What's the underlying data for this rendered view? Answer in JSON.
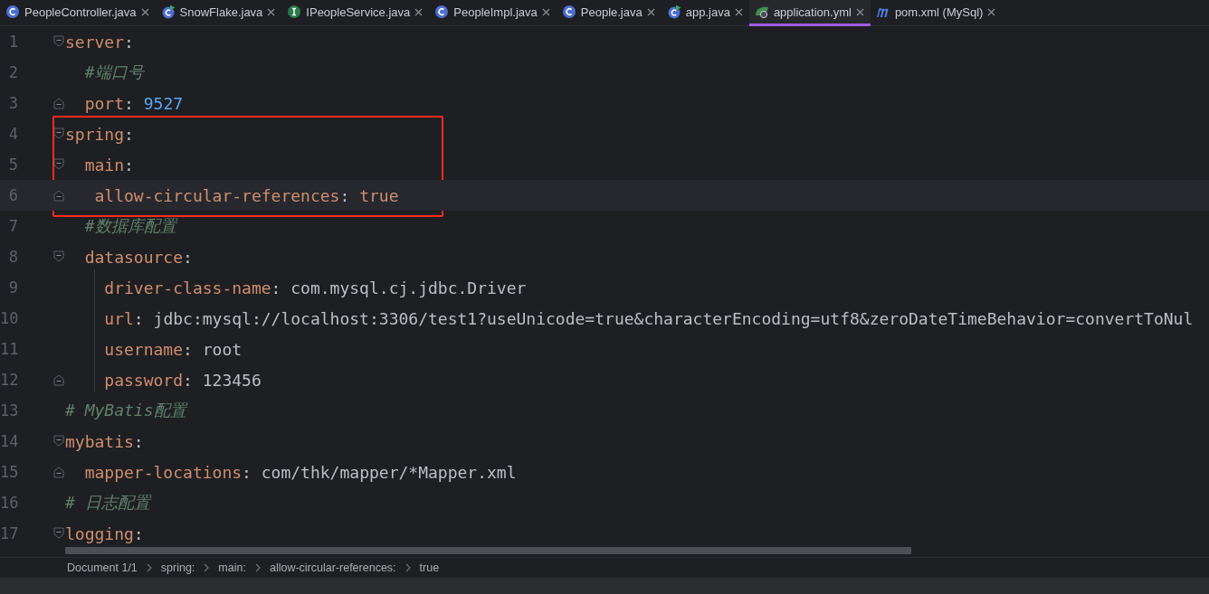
{
  "tabs": [
    {
      "label": "PeopleController.java",
      "kind": "class",
      "selected": false
    },
    {
      "label": "SnowFlake.java",
      "kind": "runnable",
      "selected": false
    },
    {
      "label": "IPeopleService.java",
      "kind": "interface",
      "selected": false
    },
    {
      "label": "PeopleImpl.java",
      "kind": "class",
      "selected": false
    },
    {
      "label": "People.java",
      "kind": "class",
      "selected": false
    },
    {
      "label": "app.java",
      "kind": "runnable",
      "selected": false
    },
    {
      "label": "application.yml",
      "kind": "config",
      "selected": true
    },
    {
      "label": "pom.xml (MySql)",
      "kind": "maven",
      "selected": false
    }
  ],
  "editor": {
    "lines": [
      {
        "number": "1",
        "kind": "fold-start",
        "current": false,
        "boxed": false,
        "tokens": [
          {
            "kind": "key",
            "text": "server"
          },
          {
            "kind": "punct",
            "text": ":"
          }
        ]
      },
      {
        "number": "2",
        "kind": "plain",
        "current": false,
        "boxed": false,
        "tokens": [
          {
            "kind": "comment",
            "text": "  #端口号"
          }
        ]
      },
      {
        "number": "3",
        "kind": "fold-end",
        "current": false,
        "boxed": false,
        "tokens": [
          {
            "kind": "key",
            "text": "  port"
          },
          {
            "kind": "punct",
            "text": ": "
          },
          {
            "kind": "number",
            "text": "9527"
          }
        ]
      },
      {
        "number": "4",
        "kind": "fold-start",
        "current": false,
        "boxed": true,
        "tokens": [
          {
            "kind": "key",
            "text": "spring"
          },
          {
            "kind": "punct",
            "text": ":"
          }
        ]
      },
      {
        "number": "5",
        "kind": "fold-start",
        "current": false,
        "boxed": true,
        "tokens": [
          {
            "kind": "key",
            "text": "  main"
          },
          {
            "kind": "punct",
            "text": ":"
          }
        ]
      },
      {
        "number": "6",
        "kind": "fold-end",
        "current": true,
        "boxed": true,
        "tokens": [
          {
            "kind": "key",
            "text": "   allow-circular-references"
          },
          {
            "kind": "punct",
            "text": ": "
          },
          {
            "kind": "keyword",
            "text": "true"
          }
        ]
      },
      {
        "number": "7",
        "kind": "plain",
        "current": false,
        "boxed": false,
        "tokens": [
          {
            "kind": "comment",
            "text": "  #数据库配置"
          }
        ]
      },
      {
        "number": "8",
        "kind": "fold-start",
        "current": false,
        "boxed": false,
        "tokens": [
          {
            "kind": "key",
            "text": "  datasource"
          },
          {
            "kind": "punct",
            "text": ":"
          }
        ]
      },
      {
        "number": "9",
        "kind": "plain",
        "current": false,
        "boxed": false,
        "tokens": [
          {
            "kind": "key",
            "text": "    driver-class-name"
          },
          {
            "kind": "punct",
            "text": ": "
          },
          {
            "kind": "value",
            "text": "com.mysql.cj.jdbc.Driver"
          }
        ]
      },
      {
        "number": "10",
        "kind": "plain",
        "current": false,
        "boxed": false,
        "tokens": [
          {
            "kind": "key",
            "text": "    url"
          },
          {
            "kind": "punct",
            "text": ": "
          },
          {
            "kind": "value",
            "text": "jdbc:mysql://localhost:3306/test1?useUnicode=true&characterEncoding=utf8&zeroDateTimeBehavior=convertToNul"
          }
        ]
      },
      {
        "number": "11",
        "kind": "plain",
        "current": false,
        "boxed": false,
        "tokens": [
          {
            "kind": "key",
            "text": "    username"
          },
          {
            "kind": "punct",
            "text": ": "
          },
          {
            "kind": "value",
            "text": "root"
          }
        ]
      },
      {
        "number": "12",
        "kind": "fold-end",
        "current": false,
        "boxed": false,
        "tokens": [
          {
            "kind": "key",
            "text": "    password"
          },
          {
            "kind": "punct",
            "text": ": "
          },
          {
            "kind": "value",
            "text": "123456"
          }
        ]
      },
      {
        "number": "13",
        "kind": "plain",
        "current": false,
        "boxed": false,
        "tokens": [
          {
            "kind": "comment",
            "text": "# MyBatis配置"
          }
        ]
      },
      {
        "number": "14",
        "kind": "fold-start",
        "current": false,
        "boxed": false,
        "tokens": [
          {
            "kind": "key",
            "text": "mybatis"
          },
          {
            "kind": "punct",
            "text": ":"
          }
        ]
      },
      {
        "number": "15",
        "kind": "fold-end",
        "current": false,
        "boxed": false,
        "tokens": [
          {
            "kind": "key",
            "text": "  mapper-locations"
          },
          {
            "kind": "punct",
            "text": ": "
          },
          {
            "kind": "value",
            "text": "com/thk/mapper/*Mapper.xml"
          }
        ]
      },
      {
        "number": "16",
        "kind": "plain",
        "current": false,
        "boxed": false,
        "tokens": [
          {
            "kind": "comment",
            "text": "# 日志配置"
          }
        ]
      },
      {
        "number": "17",
        "kind": "fold-start",
        "current": false,
        "boxed": false,
        "tokens": [
          {
            "kind": "key",
            "text": "logging"
          },
          {
            "kind": "punct",
            "text": ":"
          }
        ]
      }
    ]
  },
  "breadcrumbs": [
    "Document 1/1",
    "spring:",
    "main:",
    "allow-circular-references:",
    "true"
  ]
}
